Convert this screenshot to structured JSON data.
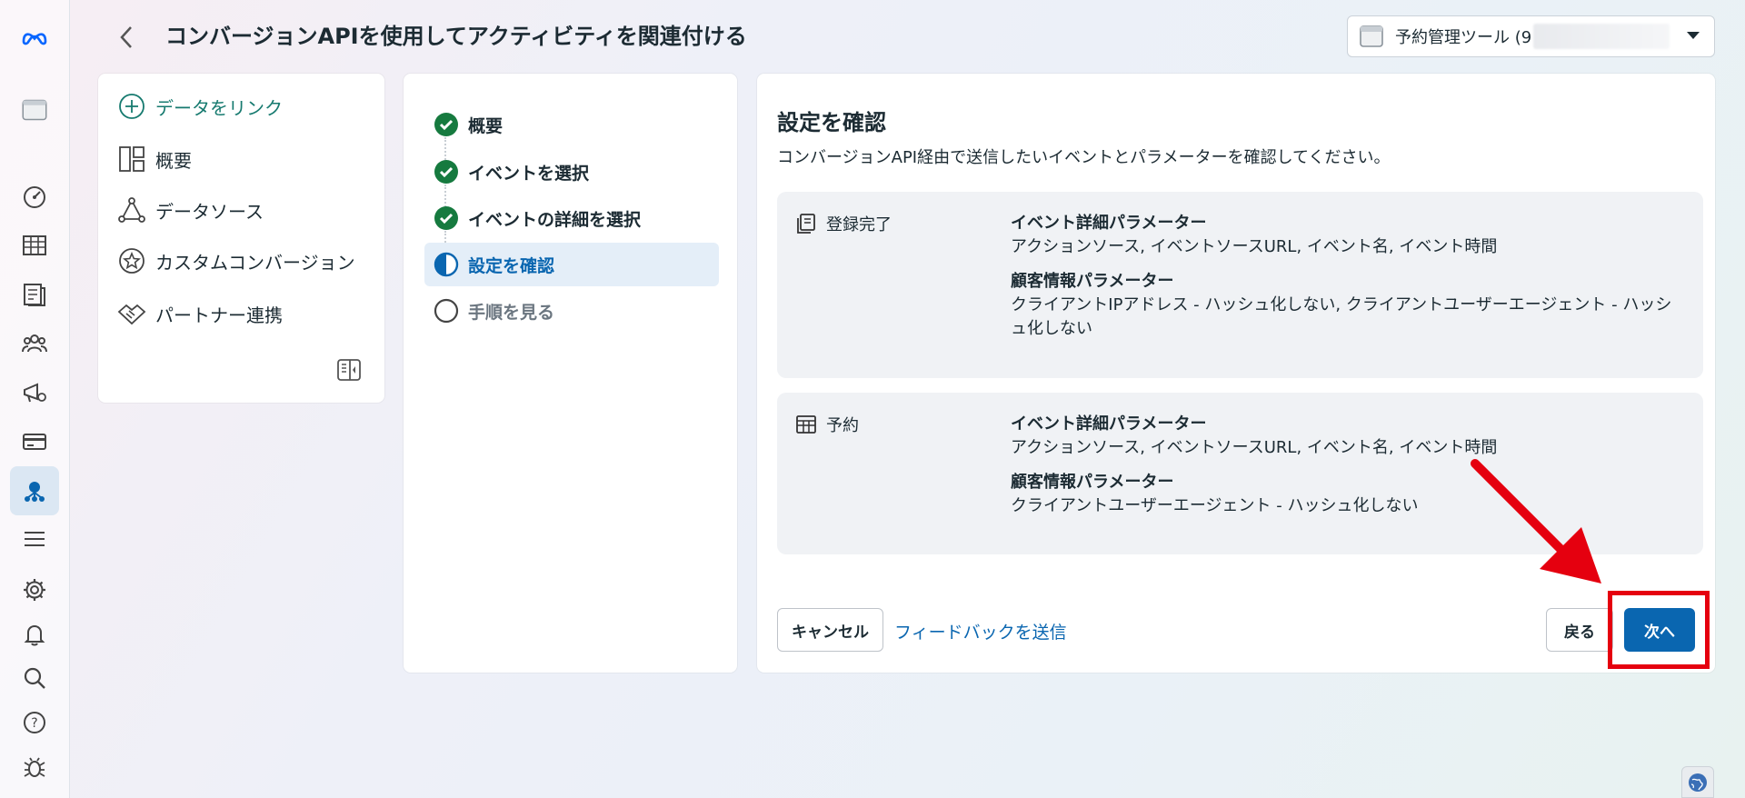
{
  "header": {
    "title": "コンバージョンAPIを使用してアクティビティを関連付ける",
    "account_label": "予約管理ツール (9"
  },
  "rail": {
    "icons": [
      "meta-logo",
      "business-portfolio",
      "dashboard",
      "table",
      "reports",
      "audience",
      "ads-manager",
      "billing",
      "events-manager",
      "menu",
      "settings",
      "notifications",
      "search",
      "help",
      "bug-report"
    ]
  },
  "nav": {
    "items": [
      {
        "label": "データをリンク",
        "icon": "plus-circle-icon"
      },
      {
        "label": "概要",
        "icon": "layout-icon"
      },
      {
        "label": "データソース",
        "icon": "nodes-icon"
      },
      {
        "label": "カスタムコンバージョン",
        "icon": "star-icon"
      },
      {
        "label": "パートナー連携",
        "icon": "handshake-icon"
      }
    ]
  },
  "steps": [
    {
      "label": "概要",
      "status": "complete"
    },
    {
      "label": "イベントを選択",
      "status": "complete"
    },
    {
      "label": "イベントの詳細を選択",
      "status": "complete"
    },
    {
      "label": "設定を確認",
      "status": "current"
    },
    {
      "label": "手順を見る",
      "status": "pending"
    }
  ],
  "main": {
    "title": "設定を確認",
    "description": "コンバージョンAPI経由で送信したいイベントとパラメーターを確認してください。",
    "events": [
      {
        "name": "登録完了",
        "event_param_title": "イベント詳細パラメーター",
        "event_params": "アクションソース, イベントソースURL, イベント名, イベント時間",
        "customer_param_title": "顧客情報パラメーター",
        "customer_params": "クライアントIPアドレス - ハッシュ化しない, クライアントユーザーエージェント - ハッシュ化しない"
      },
      {
        "name": "予約",
        "event_param_title": "イベント詳細パラメーター",
        "event_params": "アクションソース, イベントソースURL, イベント名, イベント時間",
        "customer_param_title": "顧客情報パラメーター",
        "customer_params": "クライアントユーザーエージェント - ハッシュ化しない"
      }
    ],
    "cancel_label": "キャンセル",
    "feedback_label": "フィードバックを送信",
    "back_label": "戻る",
    "next_label": "次へ"
  },
  "colors": {
    "accent": "#0a66b0",
    "success": "#167a3f",
    "annotation": "#e5000f"
  }
}
